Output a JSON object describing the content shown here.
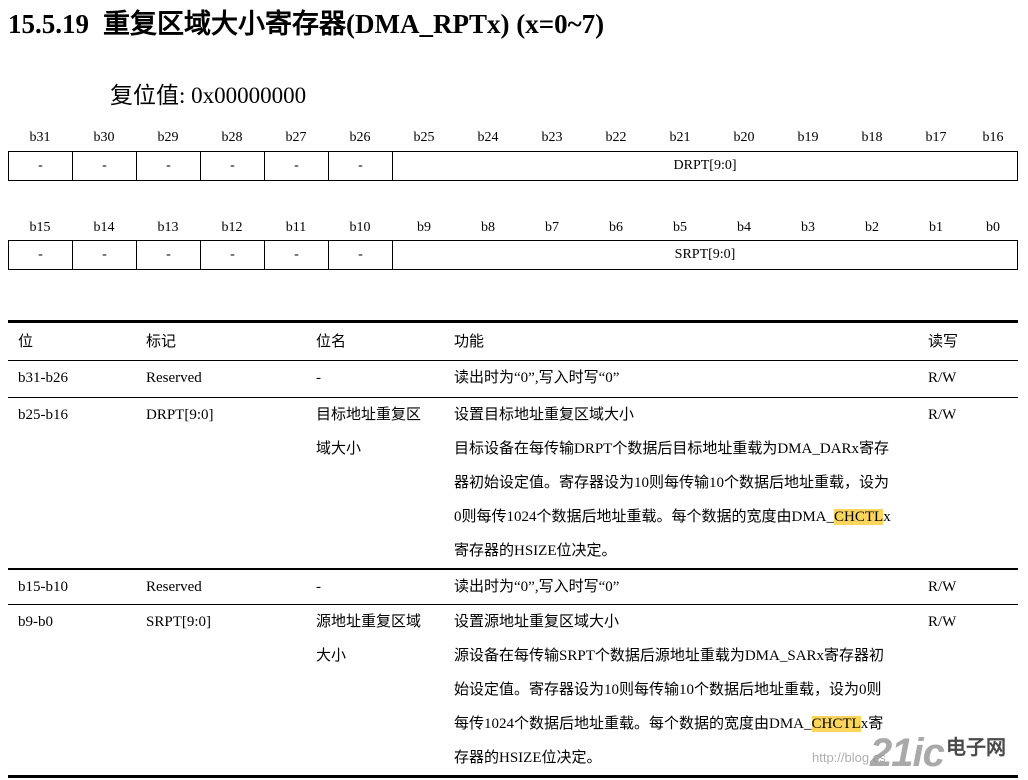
{
  "section": {
    "number": "15.5.19",
    "title": "重复区域大小寄存器(DMA_RPTx) (x=0~7)"
  },
  "reset_value": "复位值: 0x00000000",
  "registers": [
    {
      "bits": [
        "b31",
        "b30",
        "b29",
        "b28",
        "b27",
        "b26",
        "b25",
        "b24",
        "b23",
        "b22",
        "b21",
        "b20",
        "b19",
        "b18",
        "b17",
        "b16"
      ],
      "fields": [
        "-",
        "-",
        "-",
        "-",
        "-",
        "-",
        "DRPT[9:0]"
      ]
    },
    {
      "bits": [
        "b15",
        "b14",
        "b13",
        "b12",
        "b11",
        "b10",
        "b9",
        "b8",
        "b7",
        "b6",
        "b5",
        "b4",
        "b3",
        "b2",
        "b1",
        "b0"
      ],
      "fields": [
        "-",
        "-",
        "-",
        "-",
        "-",
        "-",
        "SRPT[9:0]"
      ]
    }
  ],
  "bit_table": {
    "headers": [
      "位",
      "标记",
      "位名",
      "功能",
      "读写"
    ],
    "rows": [
      {
        "bits": "b31-b26",
        "mark": "Reserved",
        "name": [
          "-"
        ],
        "func": [
          {
            "pre": "读出时为“0”,写入时写“0”"
          }
        ],
        "rw": "R/W"
      },
      {
        "bits": "b25-b16",
        "mark": "DRPT[9:0]",
        "name": [
          "目标地址重复区",
          "域大小"
        ],
        "func": [
          {
            "pre": "设置目标地址重复区域大小"
          },
          {
            "pre": "目标设备在每传输DRPT个数据后目标地址重载为DMA_DARx寄存"
          },
          {
            "pre": "器初始设定值。寄存器设为10则每传输10个数据后地址重载，设为"
          },
          {
            "pre": "0则每传1024个数据后地址重载。每个数据的宽度由DMA_",
            "hl": "CHCTL",
            "post": "x"
          },
          {
            "pre": "寄存器的HSIZE位决定。"
          }
        ],
        "rw": "R/W"
      },
      {
        "bits": "b15-b10",
        "mark": "Reserved",
        "name": [
          "-"
        ],
        "func": [
          {
            "pre": "读出时为“0”,写入时写“0”"
          }
        ],
        "rw": "R/W"
      },
      {
        "bits": "b9-b0",
        "mark": "SRPT[9:0]",
        "name": [
          "源地址重复区域",
          "大小"
        ],
        "func": [
          {
            "pre": "设置源地址重复区域大小"
          },
          {
            "pre": "源设备在每传输SRPT个数据后源地址重载为DMA_SARx寄存器初"
          },
          {
            "pre": "始设定值。寄存器设为10则每传输10个数据后地址重载，设为0则"
          },
          {
            "pre": "每传1024个数据后地址重载。每个数据的宽度由DMA_",
            "hl": "CHCTL",
            "post": "x寄"
          },
          {
            "pre": "存器的HSIZE位决定。"
          }
        ],
        "rw": "R/W"
      }
    ]
  },
  "colors": {
    "highlight": "#FDD55C"
  },
  "watermark": {
    "logo": "21ic",
    "name": "电子网",
    "url": "http://blog.cs"
  }
}
